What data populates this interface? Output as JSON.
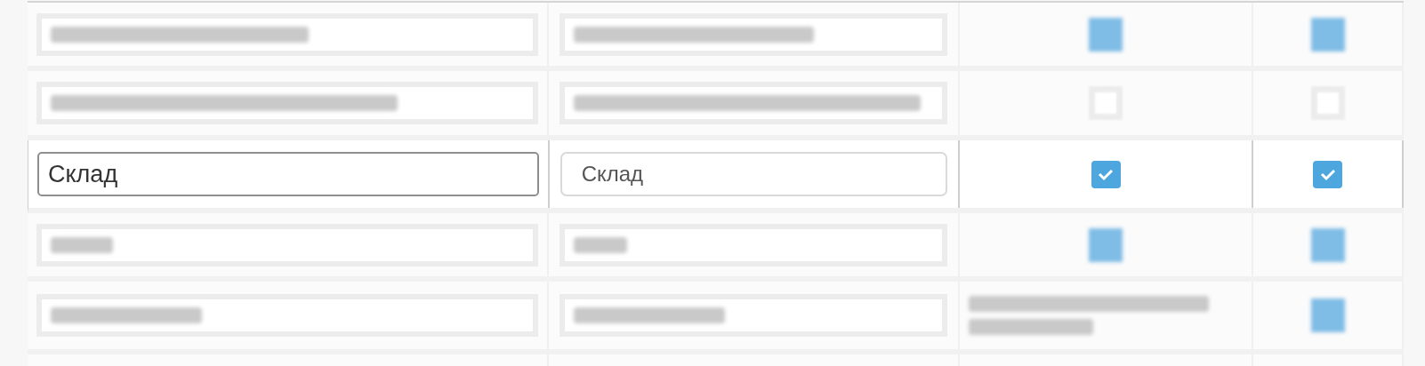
{
  "table": {
    "rows": [
      {
        "kind": "blurred",
        "flags": [
          {
            "kind": "checkbox",
            "checked": true
          },
          {
            "kind": "checkbox",
            "checked": true
          }
        ]
      },
      {
        "kind": "blurred",
        "flags": [
          {
            "kind": "checkbox",
            "checked": false
          },
          {
            "kind": "checkbox",
            "checked": false
          }
        ]
      },
      {
        "kind": "edit",
        "name": "Склад",
        "title": "Склад",
        "flags": [
          {
            "kind": "checkbox",
            "checked": true
          },
          {
            "kind": "checkbox",
            "checked": true
          }
        ]
      },
      {
        "kind": "blurred",
        "flags": [
          {
            "kind": "checkbox",
            "checked": true
          },
          {
            "kind": "checkbox",
            "checked": true
          }
        ]
      },
      {
        "kind": "blurred",
        "flags": [
          {
            "kind": "blurred_text"
          },
          {
            "kind": "checkbox",
            "checked": true
          }
        ]
      },
      {
        "kind": "partial"
      }
    ]
  }
}
